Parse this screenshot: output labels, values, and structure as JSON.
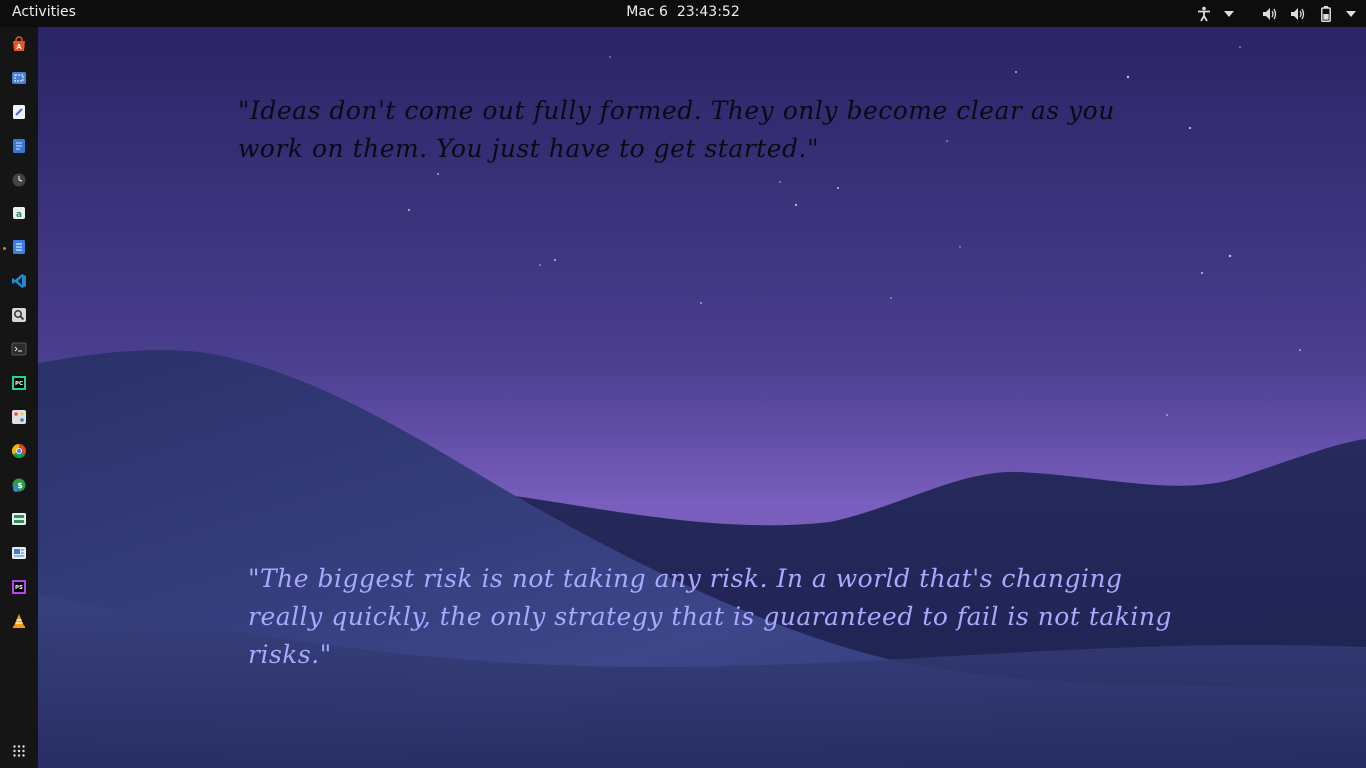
{
  "topbar": {
    "activities_label": "Activities",
    "date": "Mac 6",
    "time": "23:43:52",
    "tray_icons": [
      "accessibility-icon",
      "volume-icon",
      "volume-icon",
      "battery-icon"
    ]
  },
  "dock": {
    "apps": [
      {
        "name": "ubuntu-software-icon",
        "color": "#e95420"
      },
      {
        "name": "screenshot-icon",
        "color": "#4a7fd8"
      },
      {
        "name": "text-editor-icon",
        "color": "#3b6fd6"
      },
      {
        "name": "notes-icon",
        "color": "#3a78d6"
      },
      {
        "name": "clock-icon",
        "color": "#555555"
      },
      {
        "name": "archive-icon",
        "color": "#2e8b57"
      },
      {
        "name": "document-viewer-icon",
        "color": "#3d7fe0",
        "running": true
      },
      {
        "name": "vscode-icon",
        "color": "#1f8ad2"
      },
      {
        "name": "search-icon",
        "color": "#777777"
      },
      {
        "name": "terminal-icon",
        "color": "#2c2c2c"
      },
      {
        "name": "pycharm-icon",
        "color": "#21d789"
      },
      {
        "name": "image-viewer-icon",
        "color": "#888888"
      },
      {
        "name": "chrome-icon",
        "color": "#db4437"
      },
      {
        "name": "money-manager-icon",
        "color": "#2a9d4a"
      },
      {
        "name": "system-monitor-icon",
        "color": "#2f8f5a"
      },
      {
        "name": "presentation-icon",
        "color": "#3b7dd8"
      },
      {
        "name": "phpstorm-icon",
        "color": "#b345f1"
      },
      {
        "name": "vlc-icon",
        "color": "#f39c12"
      }
    ],
    "show_apps_icon": "grid-icon"
  },
  "desktop": {
    "quote_top": "\"Ideas don't come out fully formed. They only become clear as you work on them. You just have to get started.\"",
    "quote_bottom": "\"The biggest risk is not taking any risk. In a world that's changing really quickly, the only strategy that is guaranteed to fail is not taking risks.\""
  }
}
